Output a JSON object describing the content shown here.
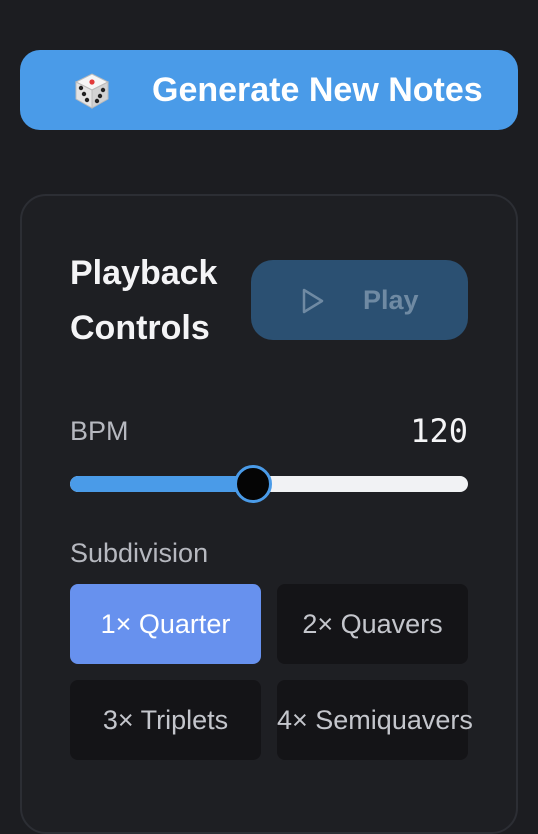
{
  "generate": {
    "label": "Generate New Notes",
    "icon": "dice-icon"
  },
  "playback": {
    "title": "Playback Controls",
    "play_label": "Play",
    "play_icon": "play-icon"
  },
  "bpm": {
    "label": "BPM",
    "value": "120",
    "fraction": 0.46
  },
  "subdivision": {
    "label": "Subdivision",
    "options": [
      {
        "label": "1× Quarter",
        "selected": true
      },
      {
        "label": "2× Quavers",
        "selected": false
      },
      {
        "label": "3× Triplets",
        "selected": false
      },
      {
        "label": "4× Semiquavers",
        "selected": false
      }
    ]
  },
  "colors": {
    "accent": "#4a9be8",
    "selected": "#6791ee",
    "background": "#1c1d21"
  }
}
